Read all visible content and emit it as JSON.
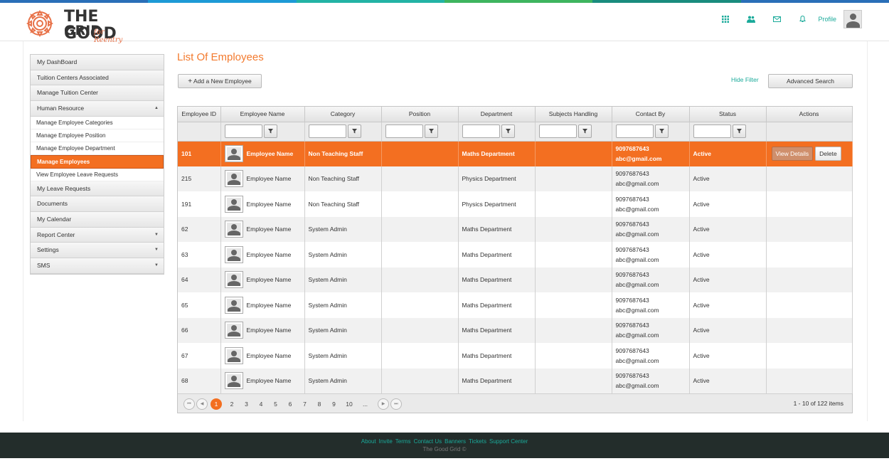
{
  "brand": {
    "line1": "THE GOOD",
    "line2": "GRID",
    "tagline": "for Reentry",
    "accent_color": "#f36f21",
    "link_color": "#1aaa9a",
    "stripe_colors": [
      "#2a6fb8",
      "#1d9ad6",
      "#23b3a5",
      "#3eb55f",
      "#1a8c7e",
      "#2a6fb8"
    ]
  },
  "topnav": {
    "icons": [
      "grid-icon",
      "users-icon",
      "mail-icon",
      "bell-icon"
    ],
    "profile_label": "Profile"
  },
  "sidebar": {
    "items": [
      {
        "label": "My DashBoard",
        "type": "item"
      },
      {
        "label": "Tuition Centers Associated",
        "type": "item"
      },
      {
        "label": "Manage Tuition Center",
        "type": "item"
      },
      {
        "label": "Human Resource",
        "type": "item",
        "caret": "▲"
      },
      {
        "label": "Manage Employee Categories",
        "type": "sub"
      },
      {
        "label": "Manage Employee Position",
        "type": "sub"
      },
      {
        "label": "Manage Employee Department",
        "type": "sub"
      },
      {
        "label": "Manage Employees",
        "type": "sub",
        "active": true
      },
      {
        "label": "View Employee Leave Requests",
        "type": "sub"
      },
      {
        "label": "My Leave Requests",
        "type": "item"
      },
      {
        "label": "Documents",
        "type": "item"
      },
      {
        "label": "My Calendar",
        "type": "item"
      },
      {
        "label": "Report Center",
        "type": "item",
        "caret": "▼"
      },
      {
        "label": "Settings",
        "type": "item",
        "caret": "▼"
      },
      {
        "label": "SMS",
        "type": "item",
        "caret": "▼"
      }
    ]
  },
  "main": {
    "title": "List Of Employees",
    "add_button": "Add a New Employee",
    "add_icon": "+",
    "hide_filter": "Hide Filter",
    "advanced_search": "Advanced Search"
  },
  "table": {
    "columns": [
      "Employee ID",
      "Employee Name",
      "Category",
      "Position",
      "Department",
      "Subjects Handling",
      "Contact By",
      "Status",
      "Actions"
    ],
    "filter_columns": [
      false,
      true,
      true,
      true,
      true,
      true,
      true,
      true,
      false
    ],
    "rows": [
      {
        "id": "101",
        "name": "Employee Name",
        "category": "Non Teaching Staff",
        "position": "",
        "department": "Maths Department",
        "subjects": "",
        "phone": "9097687643",
        "email": "abc@gmail.com",
        "status": "Active",
        "selected": true,
        "actions": [
          "View Details",
          "Delete"
        ]
      },
      {
        "id": "215",
        "name": "Employee Name",
        "category": "Non Teaching Staff",
        "position": "",
        "department": "Physics Department",
        "subjects": "",
        "phone": "9097687643",
        "email": "abc@gmail.com",
        "status": "Active"
      },
      {
        "id": "191",
        "name": "Employee Name",
        "category": "Non Teaching Staff",
        "position": "",
        "department": "Physics Department",
        "subjects": "",
        "phone": "9097687643",
        "email": "abc@gmail.com",
        "status": "Active"
      },
      {
        "id": "62",
        "name": "Employee Name",
        "category": "System Admin",
        "position": "",
        "department": "Maths Department",
        "subjects": "",
        "phone": "9097687643",
        "email": "abc@gmail.com",
        "status": "Active"
      },
      {
        "id": "63",
        "name": "Employee Name",
        "category": "System Admin",
        "position": "",
        "department": "Maths Department",
        "subjects": "",
        "phone": "9097687643",
        "email": "abc@gmail.com",
        "status": "Active"
      },
      {
        "id": "64",
        "name": "Employee Name",
        "category": "System Admin",
        "position": "",
        "department": "Maths Department",
        "subjects": "",
        "phone": "9097687643",
        "email": "abc@gmail.com",
        "status": "Active"
      },
      {
        "id": "65",
        "name": "Employee Name",
        "category": "System Admin",
        "position": "",
        "department": "Maths Department",
        "subjects": "",
        "phone": "9097687643",
        "email": "abc@gmail.com",
        "status": "Active"
      },
      {
        "id": "66",
        "name": "Employee Name",
        "category": "System Admin",
        "position": "",
        "department": "Maths Department",
        "subjects": "",
        "phone": "9097687643",
        "email": "abc@gmail.com",
        "status": "Active"
      },
      {
        "id": "67",
        "name": "Employee Name",
        "category": "System Admin",
        "position": "",
        "department": "Maths Department",
        "subjects": "",
        "phone": "9097687643",
        "email": "abc@gmail.com",
        "status": "Active"
      },
      {
        "id": "68",
        "name": "Employee Name",
        "category": "System Admin",
        "position": "",
        "department": "Maths Department",
        "subjects": "",
        "phone": "9097687643",
        "email": "abc@gmail.com",
        "status": "Active"
      }
    ]
  },
  "pager": {
    "nav_first": "⏮",
    "nav_prev": "◀",
    "nav_next": "▶",
    "nav_last": "⏭",
    "pages": [
      "1",
      "2",
      "3",
      "4",
      "5",
      "6",
      "7",
      "8",
      "9",
      "10",
      "..."
    ],
    "current": "1",
    "info": "1 - 10 of 122 items"
  },
  "footer": {
    "links": [
      "About",
      "Invite",
      "Terms",
      "Contact Us",
      "Banners",
      "Tickets",
      "Support Center"
    ],
    "copyright": "The Good Grid ©"
  }
}
